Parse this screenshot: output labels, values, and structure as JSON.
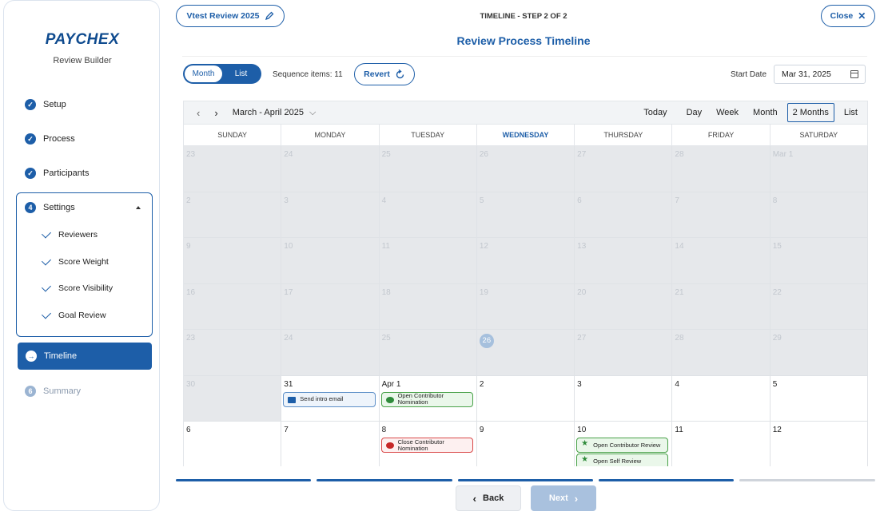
{
  "sidebar": {
    "logo": "PAYCHEX",
    "subtitle": "Review Builder",
    "steps": [
      {
        "num": "✓",
        "label": "Setup"
      },
      {
        "num": "✓",
        "label": "Process"
      },
      {
        "num": "✓",
        "label": "Participants"
      },
      {
        "num": "4",
        "label": "Settings"
      },
      {
        "num": "→",
        "label": "Timeline"
      },
      {
        "num": "6",
        "label": "Summary"
      }
    ],
    "settings_items": [
      "Reviewers",
      "Score Weight",
      "Score Visibility",
      "Goal Review"
    ]
  },
  "header": {
    "review_name": "Vtest Review 2025",
    "edit_icon": "pencil-icon",
    "step_indicator": "TIMELINE - STEP 2 OF 2",
    "title": "Review Process Timeline",
    "close_label": "Close"
  },
  "controls": {
    "toggle": [
      "Month",
      "List"
    ],
    "sequence_items": "Sequence items: 11",
    "revert_label": "Revert",
    "start_date_label": "Start Date",
    "start_date_value": "Mar 31, 2025"
  },
  "calendar": {
    "range_label": "March - April 2025",
    "today_label": "Today",
    "views": [
      "Day",
      "Week",
      "Month",
      "2 Months",
      "List"
    ],
    "selected_view": "2 Months",
    "weekdays": [
      "SUNDAY",
      "MONDAY",
      "TUESDAY",
      "WEDNESDAY",
      "THURSDAY",
      "FRIDAY",
      "SATURDAY"
    ],
    "weeks": [
      [
        "23",
        "24",
        "25",
        "26",
        "27",
        "28",
        "Mar 1"
      ],
      [
        "2",
        "3",
        "4",
        "5",
        "6",
        "7",
        "8"
      ],
      [
        "9",
        "10",
        "11",
        "12",
        "13",
        "14",
        "15"
      ],
      [
        "16",
        "17",
        "18",
        "19",
        "20",
        "21",
        "22"
      ],
      [
        "23",
        "24",
        "25",
        "26",
        "27",
        "28",
        "29"
      ],
      [
        "30",
        "31",
        "Apr 1",
        "2",
        "3",
        "4",
        "5"
      ],
      [
        "6",
        "7",
        "8",
        "9",
        "10",
        "11",
        "12"
      ]
    ],
    "events": {
      "send_intro": "Send intro email",
      "open_contrib_nom": "Open Contributor Nomination",
      "close_contrib_nom": "Close Contributor Nomination",
      "open_contrib_review": "Open Contributor Review",
      "open_self_review": "Open Self Review"
    }
  },
  "footer": {
    "back_label": "Back",
    "next_label": "Next",
    "progress": [
      1,
      1,
      1,
      1,
      0
    ]
  },
  "colors": {
    "accent": "#1d5ea8",
    "brand": "#0f4b8f"
  }
}
